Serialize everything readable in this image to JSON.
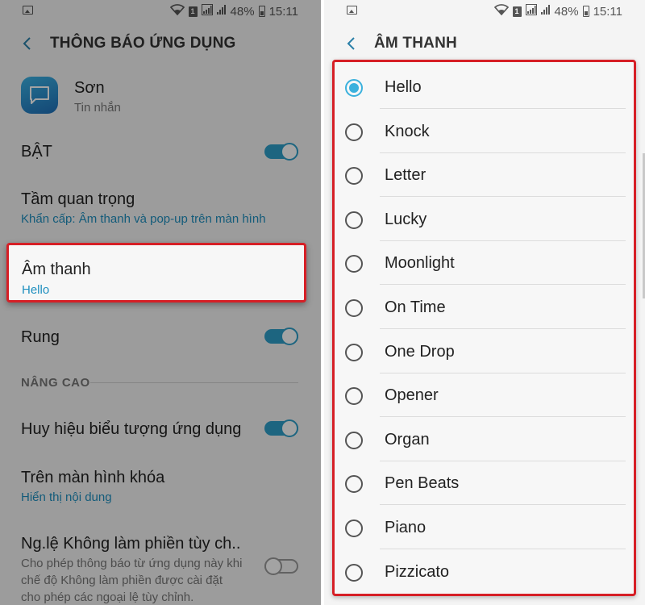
{
  "left_screen": {
    "status": {
      "battery": "48%",
      "time": "15:11",
      "sim": "1"
    },
    "header": {
      "title": "THÔNG BÁO ỨNG DỤNG"
    },
    "app": {
      "name": "Sơn",
      "category": "Tin nhắn"
    },
    "settings": {
      "on_label": "BẬT",
      "importance_title": "Tầm quan trọng",
      "importance_value": "Khẩn cấp: Âm thanh và pop-up trên màn hình",
      "sound_title": "Âm thanh",
      "sound_value": "Hello",
      "vibrate_title": "Rung",
      "advanced_label": "NÂNG CAO",
      "badge_title": "Huy hiệu biểu tượng ứng dụng",
      "lockscreen_title": "Trên màn hình khóa",
      "lockscreen_value": "Hiển thị nội dung",
      "dnd_title": "Ng.lệ Không làm phiền tùy ch..",
      "dnd_desc": "Cho phép thông báo từ ứng dụng này khi chế độ Không làm phiền được cài đặt cho phép các ngoại lệ tùy chỉnh."
    },
    "toggles": {
      "on": true,
      "vibrate": true,
      "badge": true,
      "dnd": false
    }
  },
  "right_screen": {
    "status": {
      "battery": "48%",
      "time": "15:11",
      "sim": "1"
    },
    "header": {
      "title": "ÂM THANH"
    },
    "sounds": [
      {
        "label": "Hello",
        "selected": true
      },
      {
        "label": "Knock",
        "selected": false
      },
      {
        "label": "Letter",
        "selected": false
      },
      {
        "label": "Lucky",
        "selected": false
      },
      {
        "label": "Moonlight",
        "selected": false
      },
      {
        "label": "On Time",
        "selected": false
      },
      {
        "label": "One Drop",
        "selected": false
      },
      {
        "label": "Opener",
        "selected": false
      },
      {
        "label": "Organ",
        "selected": false
      },
      {
        "label": "Pen Beats",
        "selected": false
      },
      {
        "label": "Piano",
        "selected": false
      },
      {
        "label": "Pizzicato",
        "selected": false
      }
    ]
  },
  "colors": {
    "accent": "#2e9ec9",
    "highlight_border": "#d61f26",
    "link_text": "#1e8fbf"
  }
}
